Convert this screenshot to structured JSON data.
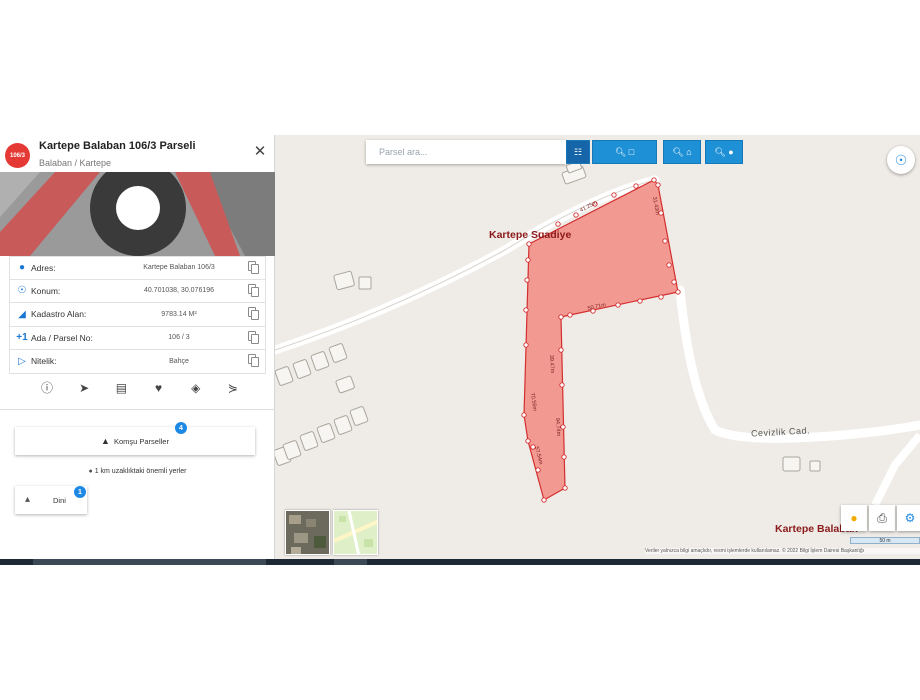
{
  "panel": {
    "badge": "106/3",
    "title": "Kartepe Balaban 106/3 Parseli",
    "subtitle": "Balaban / Kartepe",
    "rows": [
      {
        "label": "Adres:",
        "value": "Kartepe Balaban 106/3",
        "icon": "map-pin-icon"
      },
      {
        "label": "Konum:",
        "value": "40.701038, 30.076196",
        "icon": "crosshair-icon"
      },
      {
        "label": "Kadastro Alan:",
        "value": "9783.14 M²",
        "icon": "ruler-triangle-icon"
      },
      {
        "label": "Ada / Parsel No:",
        "value": "106 / 3",
        "icon": "plus-one-icon"
      },
      {
        "label": "Nitelik:",
        "value": "Bahçe",
        "icon": "tag-icon"
      }
    ],
    "neighbors_label": "Komşu Parseller",
    "neighbors_count": "4",
    "nearby_title": "1 km uzaklıktaki önemli yerler",
    "dini_label": "Dini",
    "dini_count": "1"
  },
  "search": {
    "placeholder": "Parsel ara..."
  },
  "map": {
    "labels": {
      "suadiye": "Kartepe Suadiye",
      "balaban": "Kartepe Balaban",
      "street": "Cevizlik Cad."
    },
    "scale": "50 m",
    "attribution": "Veriler yalnızca bilgi amaçlıdır, resmi işlemlerde kullanılamaz. © 2022 Bilgi İşlem Dairesi Başkanlığı",
    "edge_labels": [
      "41.25m",
      "31.43m",
      "50.71m",
      "39.47m",
      "94.74m",
      "70.56m",
      "57.54m",
      "31.22m",
      "64.42m"
    ]
  },
  "colors": {
    "accent": "#1e90d6",
    "parcel_fill": "#f28b82",
    "parcel_stroke": "#d32f2f",
    "badge": "#e53935"
  }
}
